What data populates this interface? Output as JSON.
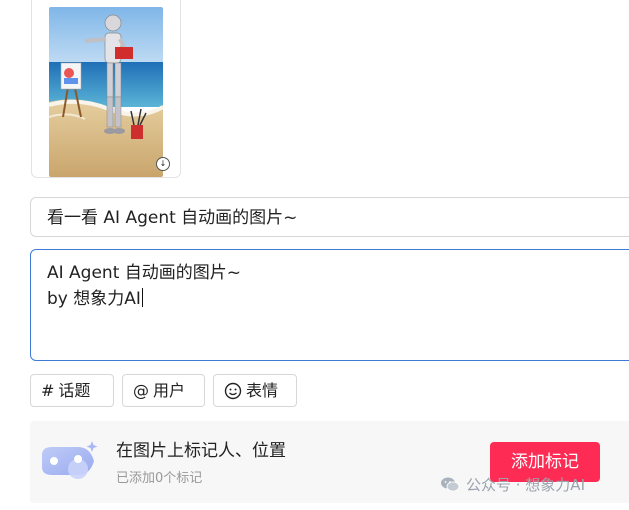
{
  "post_title": {
    "value": "看一看 AI Agent 自动画的图片~"
  },
  "description": {
    "lines": [
      "AI Agent 自动画的图片~",
      "by 想象力AI"
    ]
  },
  "chips": {
    "topic": {
      "icon": "#",
      "label": "话题"
    },
    "user": {
      "icon": "@",
      "label": "用户"
    },
    "emoji": {
      "icon": "smiley-icon",
      "label": "表情"
    }
  },
  "mark_panel": {
    "title": "在图片上标记人、位置",
    "subtitle": "已添加0个标记",
    "button_label": "添加标记"
  },
  "watermark": {
    "text": "公众号 · 想象力AI"
  },
  "colors": {
    "accent": "#fe2c55",
    "focus_border": "#3d7bd6",
    "panel_bg": "#f7f7f8"
  }
}
